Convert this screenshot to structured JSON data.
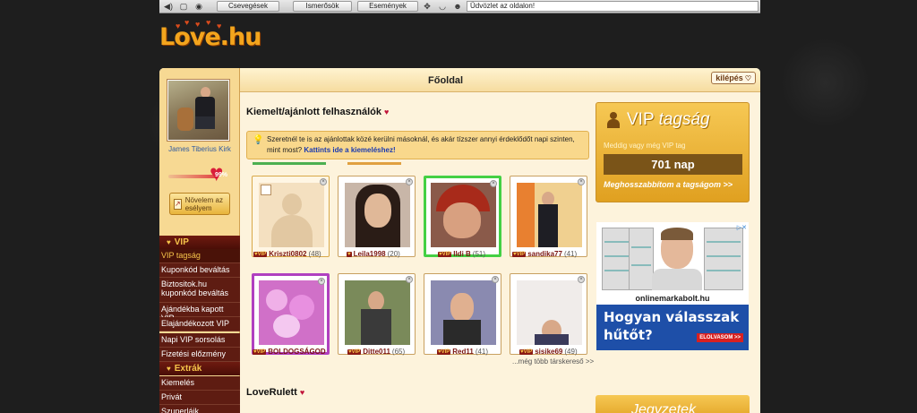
{
  "toolbar": {
    "tabs": [
      "Csevegések",
      "Ismerősök",
      "Események"
    ],
    "greeting": "Üdvözlet az oldalon!"
  },
  "logo": {
    "text": "Love.hu"
  },
  "header": {
    "title": "Főoldal",
    "logout_label": "kilépés"
  },
  "sidebar": {
    "profile_name": "James Tiberius Kirk",
    "percent": "99%",
    "boost_label": "Növelem az esélyem",
    "vip_heading": "VIP",
    "vip_items": [
      "VIP tagság",
      "Kuponkód beváltás",
      "Biztositok.hu kuponkód beváltás",
      "Ajándékba kapott VIP",
      "Elajándékozott VIP",
      "Napi VIP sorsolás",
      "Fizetési előzmény"
    ],
    "extra_heading": "Extrák",
    "extra_items": [
      "Kiemelés",
      "Privát",
      "Szuperlájk"
    ]
  },
  "featured": {
    "title": "Kiemelt/ajánlott felhasználók",
    "info_text": "Szeretnél te is az ajánlottak közé kerülni másoknál, és akár tízszer annyi érdeklődőt napi szinten, mint most?",
    "info_link": "Kattints ide a kiemeléshez!",
    "users": [
      {
        "name": "Kriszti0802",
        "age": "(48)"
      },
      {
        "name": "Leila1998",
        "age": "(20)"
      },
      {
        "name": "Ildi B",
        "age": "(51)"
      },
      {
        "name": "sandika77",
        "age": "(41)"
      },
      {
        "name": "BOLDOGSÁGOD",
        "age": ""
      },
      {
        "name": "Ditte011",
        "age": "(65)"
      },
      {
        "name": "Red11",
        "age": "(41)"
      },
      {
        "name": "sisike69",
        "age": "(49)"
      }
    ],
    "more_link": "...még több társkereső >>"
  },
  "roulette": {
    "title": "LoveRulett"
  },
  "vip_box": {
    "title_main": "VIP",
    "title_italic": "tagság",
    "subtitle": "Meddig vagy még VIP tag",
    "days": "701 nap",
    "extend_link": "Meghosszabbítom a tagságom >>"
  },
  "ad": {
    "site": "onlinemarkabolt.hu",
    "headline": "Hogyan válasszak hűtőt?",
    "cta": "ELOLVASOM >>"
  },
  "bottom_box": {
    "label": "Jegyzetek"
  },
  "colors": {
    "accent_gold": "#f6c854",
    "sidebar_dark": "#5e1c12",
    "vip_badge": "#8a1a14",
    "ad_blue": "#1e4fa8"
  }
}
